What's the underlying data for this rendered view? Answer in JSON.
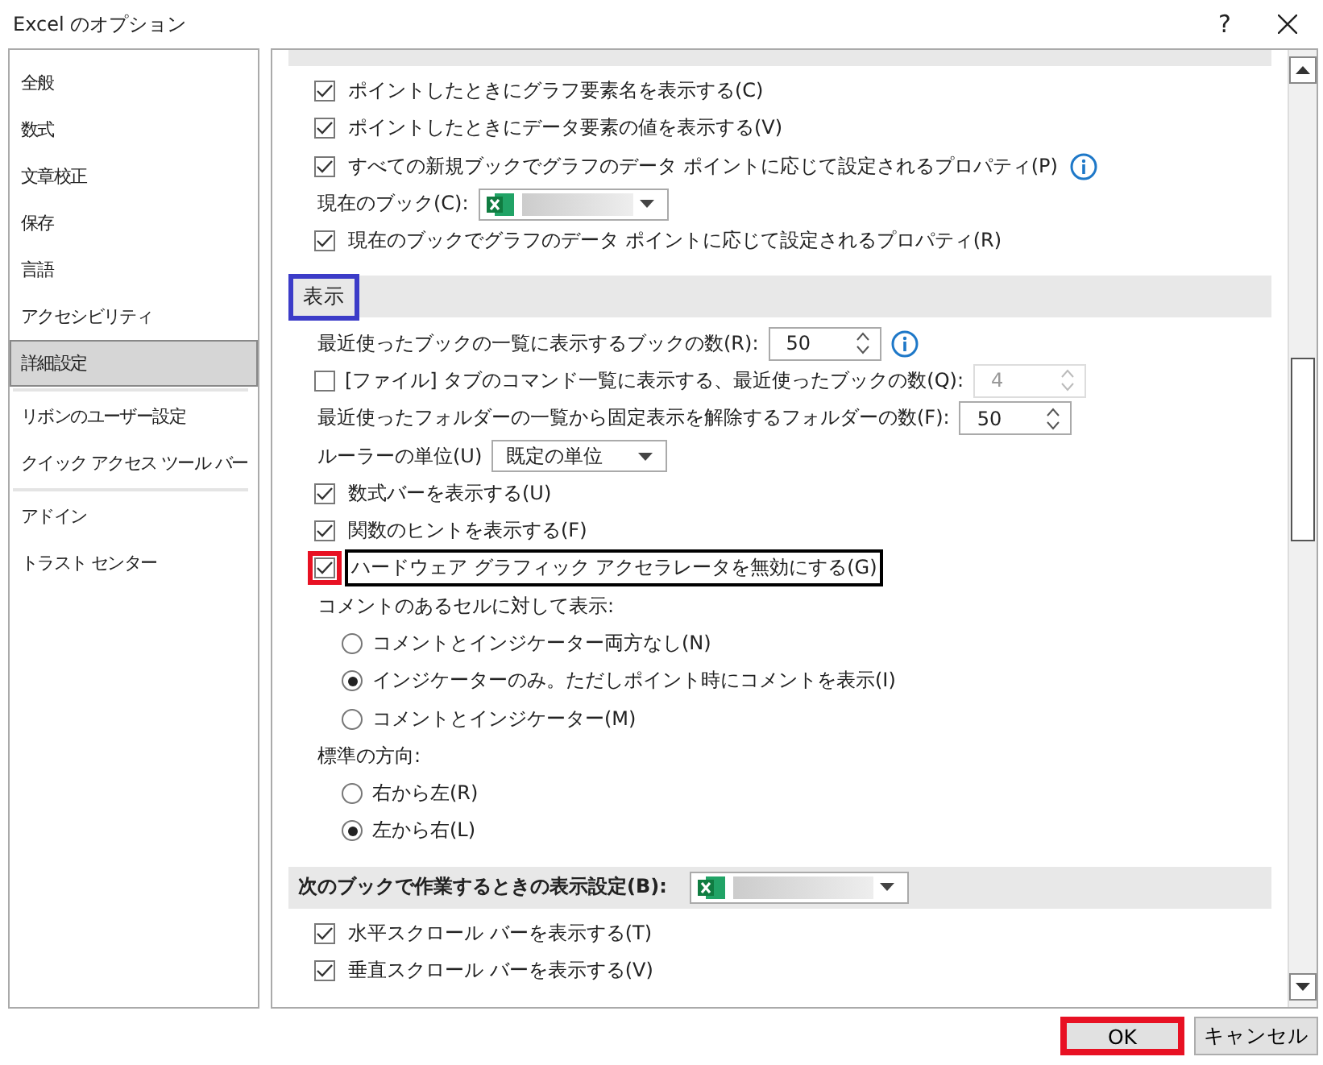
{
  "window": {
    "title": "Excel のオプション",
    "help": "?"
  },
  "sidebar": {
    "items": [
      {
        "label": "全般",
        "selected": false,
        "divider_after": false
      },
      {
        "label": "数式",
        "selected": false,
        "divider_after": false
      },
      {
        "label": "文章校正",
        "selected": false,
        "divider_after": false
      },
      {
        "label": "保存",
        "selected": false,
        "divider_after": false
      },
      {
        "label": "言語",
        "selected": false,
        "divider_after": false
      },
      {
        "label": "アクセシビリティ",
        "selected": false,
        "divider_after": false
      },
      {
        "label": "詳細設定",
        "selected": true,
        "divider_after": true
      },
      {
        "label": "リボンのユーザー設定",
        "selected": false,
        "divider_after": false
      },
      {
        "label": "クイック アクセス ツール バー",
        "selected": false,
        "divider_after": true
      },
      {
        "label": "アドイン",
        "selected": false,
        "divider_after": false
      },
      {
        "label": "トラスト センター",
        "selected": false,
        "divider_after": false
      }
    ]
  },
  "content": {
    "rows": [
      {
        "kind": "band"
      },
      {
        "kind": "checkbox",
        "label": "ポイントしたときにグラフ要素名を表示する(C)",
        "checked": true
      },
      {
        "kind": "checkbox",
        "label": "ポイントしたときにデータ要素の値を表示する(V)",
        "checked": true
      },
      {
        "kind": "checkbox",
        "label": "すべての新規ブックでグラフのデータ ポイントに応じて設定されるプロパティ(P)",
        "checked": true,
        "info": true
      },
      {
        "kind": "combo",
        "label": "現在のブック(C):"
      },
      {
        "kind": "checkbox",
        "label": "現在のブックでグラフのデータ ポイントに応じて設定されるプロパティ(R)",
        "checked": true
      },
      {
        "kind": "header",
        "label": "表示",
        "highlighted": true
      },
      {
        "kind": "spin",
        "label": "最近使ったブックの一覧に表示するブックの数(R):",
        "value": "50",
        "info": true,
        "disabled": false
      },
      {
        "kind": "checkspin",
        "label": "[ファイル] タブのコマンド一覧に表示する、最近使ったブックの数(Q):",
        "checked": false,
        "value": "4",
        "disabled": true
      },
      {
        "kind": "spin",
        "label": "最近使ったフォルダーの一覧から固定表示を解除するフォルダーの数(F):",
        "value": "50",
        "disabled": false
      },
      {
        "kind": "select",
        "label": "ルーラーの単位(U)",
        "value": "既定の単位"
      },
      {
        "kind": "checkbox",
        "label": "数式バーを表示する(U)",
        "checked": true
      },
      {
        "kind": "checkbox",
        "label": "関数のヒントを表示する(F)",
        "checked": true
      },
      {
        "kind": "checkbox",
        "label": "ハードウェア グラフィック アクセラレータを無効にする(G)",
        "checked": true,
        "box_highlighted": true,
        "label_highlighted": true
      },
      {
        "kind": "label",
        "label": "コメントのあるセルに対して表示:"
      },
      {
        "kind": "radio",
        "label": "コメントとインジケーター両方なし(N)",
        "selected": false
      },
      {
        "kind": "radio",
        "label": "インジケーターのみ。ただしポイント時にコメントを表示(I)",
        "selected": true
      },
      {
        "kind": "radio",
        "label": "コメントとインジケーター(M)",
        "selected": false
      },
      {
        "kind": "label",
        "label": "標準の方向:"
      },
      {
        "kind": "radio",
        "label": "右から左(R)",
        "selected": false
      },
      {
        "kind": "radio",
        "label": "左から右(L)",
        "selected": true
      },
      {
        "kind": "headercombo",
        "label": "次のブックで作業するときの表示設定(B):"
      },
      {
        "kind": "checkbox",
        "label": "水平スクロール バーを表示する(T)",
        "checked": true
      },
      {
        "kind": "checkbox",
        "label": "垂直スクロール バーを表示する(V)",
        "checked": true
      }
    ]
  },
  "buttons": [
    {
      "label": "OK",
      "highlighted": true
    },
    {
      "label": "キャンセル",
      "highlighted": false
    }
  ]
}
